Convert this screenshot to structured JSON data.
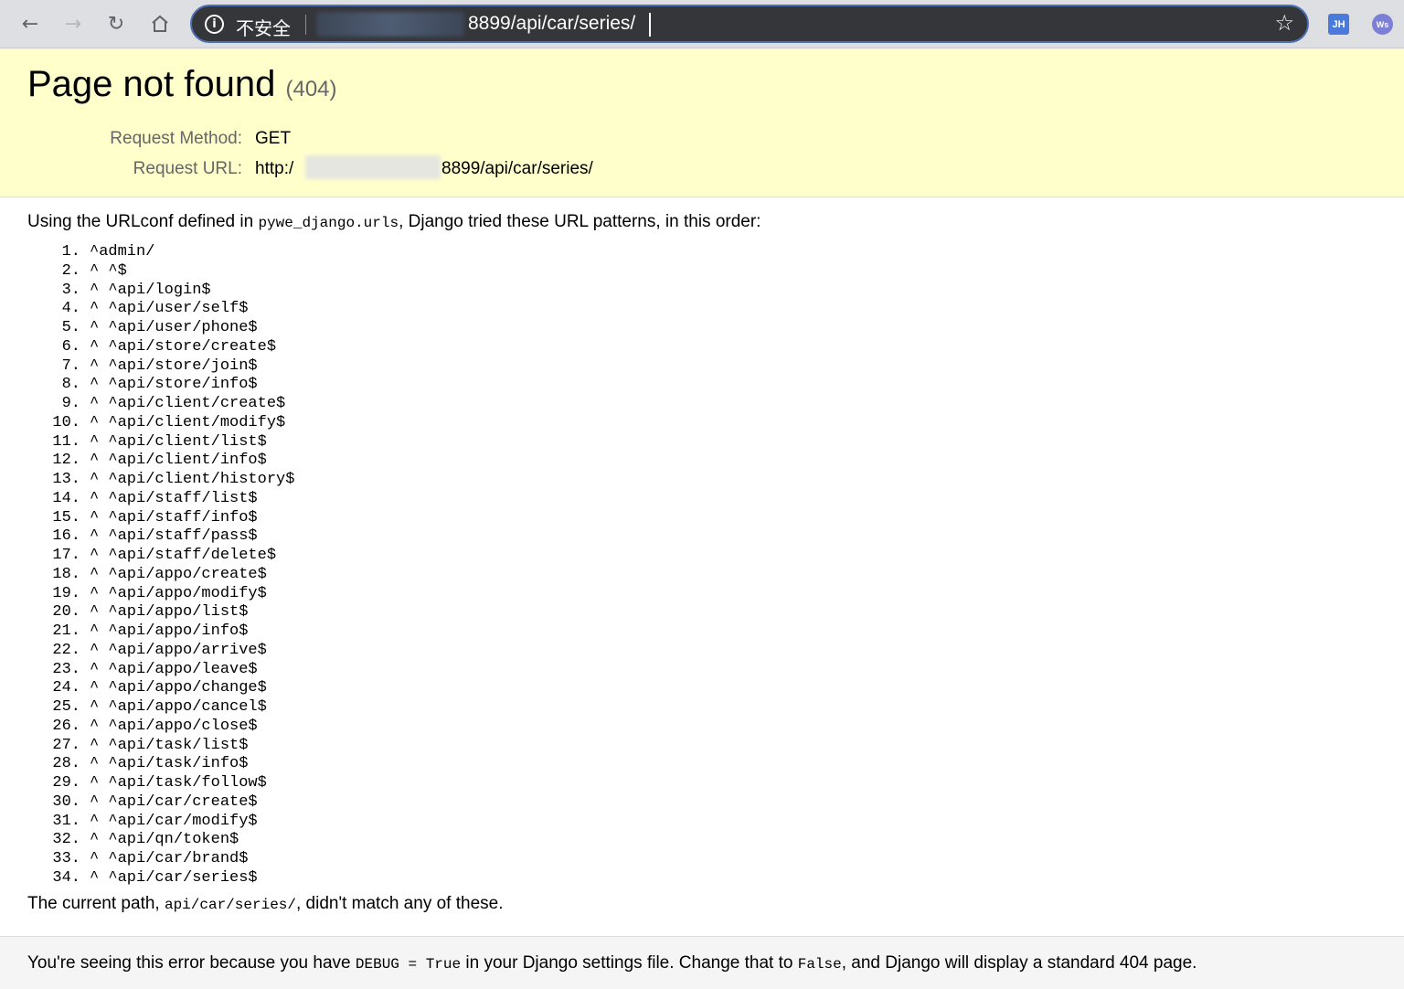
{
  "browser": {
    "security_label": "不安全",
    "url_visible": "8899/api/car/series/",
    "extensions": [
      "JH",
      "Ws"
    ]
  },
  "summary": {
    "title": "Page not found",
    "code": "(404)",
    "request_method_label": "Request Method:",
    "request_method_value": "GET",
    "request_url_label": "Request URL:",
    "request_url_prefix": "http:/",
    "request_url_suffix": "8899/api/car/series/"
  },
  "info": {
    "intro_prefix": "Using the URLconf defined in ",
    "intro_module": "pywe_django.urls",
    "intro_suffix": ", Django tried these URL patterns, in this order:",
    "patterns": [
      {
        "num": "1.",
        "text": "^admin/"
      },
      {
        "num": "2.",
        "text": "^ ^$"
      },
      {
        "num": "3.",
        "text": "^ ^api/login$"
      },
      {
        "num": "4.",
        "text": "^ ^api/user/self$"
      },
      {
        "num": "5.",
        "text": "^ ^api/user/phone$"
      },
      {
        "num": "6.",
        "text": "^ ^api/store/create$"
      },
      {
        "num": "7.",
        "text": "^ ^api/store/join$"
      },
      {
        "num": "8.",
        "text": "^ ^api/store/info$"
      },
      {
        "num": "9.",
        "text": "^ ^api/client/create$"
      },
      {
        "num": "10.",
        "text": "^ ^api/client/modify$"
      },
      {
        "num": "11.",
        "text": "^ ^api/client/list$"
      },
      {
        "num": "12.",
        "text": "^ ^api/client/info$"
      },
      {
        "num": "13.",
        "text": "^ ^api/client/history$"
      },
      {
        "num": "14.",
        "text": "^ ^api/staff/list$"
      },
      {
        "num": "15.",
        "text": "^ ^api/staff/info$"
      },
      {
        "num": "16.",
        "text": "^ ^api/staff/pass$"
      },
      {
        "num": "17.",
        "text": "^ ^api/staff/delete$"
      },
      {
        "num": "18.",
        "text": "^ ^api/appo/create$"
      },
      {
        "num": "19.",
        "text": "^ ^api/appo/modify$"
      },
      {
        "num": "20.",
        "text": "^ ^api/appo/list$"
      },
      {
        "num": "21.",
        "text": "^ ^api/appo/info$"
      },
      {
        "num": "22.",
        "text": "^ ^api/appo/arrive$"
      },
      {
        "num": "23.",
        "text": "^ ^api/appo/leave$"
      },
      {
        "num": "24.",
        "text": "^ ^api/appo/change$"
      },
      {
        "num": "25.",
        "text": "^ ^api/appo/cancel$"
      },
      {
        "num": "26.",
        "text": "^ ^api/appo/close$"
      },
      {
        "num": "27.",
        "text": "^ ^api/task/list$"
      },
      {
        "num": "28.",
        "text": "^ ^api/task/info$"
      },
      {
        "num": "29.",
        "text": "^ ^api/task/follow$"
      },
      {
        "num": "30.",
        "text": "^ ^api/car/create$"
      },
      {
        "num": "31.",
        "text": "^ ^api/car/modify$"
      },
      {
        "num": "32.",
        "text": "^ ^api/qn/token$"
      },
      {
        "num": "33.",
        "text": "^ ^api/car/brand$"
      },
      {
        "num": "34.",
        "text": "^ ^api/car/series$"
      }
    ],
    "current_prefix": "The current path, ",
    "current_path": "api/car/series/",
    "current_suffix": ", didn't match any of these."
  },
  "explanation": {
    "part1": "You're seeing this error because you have ",
    "code1": "DEBUG = True",
    "part2": " in your Django settings file. Change that to ",
    "code2": "False",
    "part3": ", and Django will display a standard 404 page."
  }
}
